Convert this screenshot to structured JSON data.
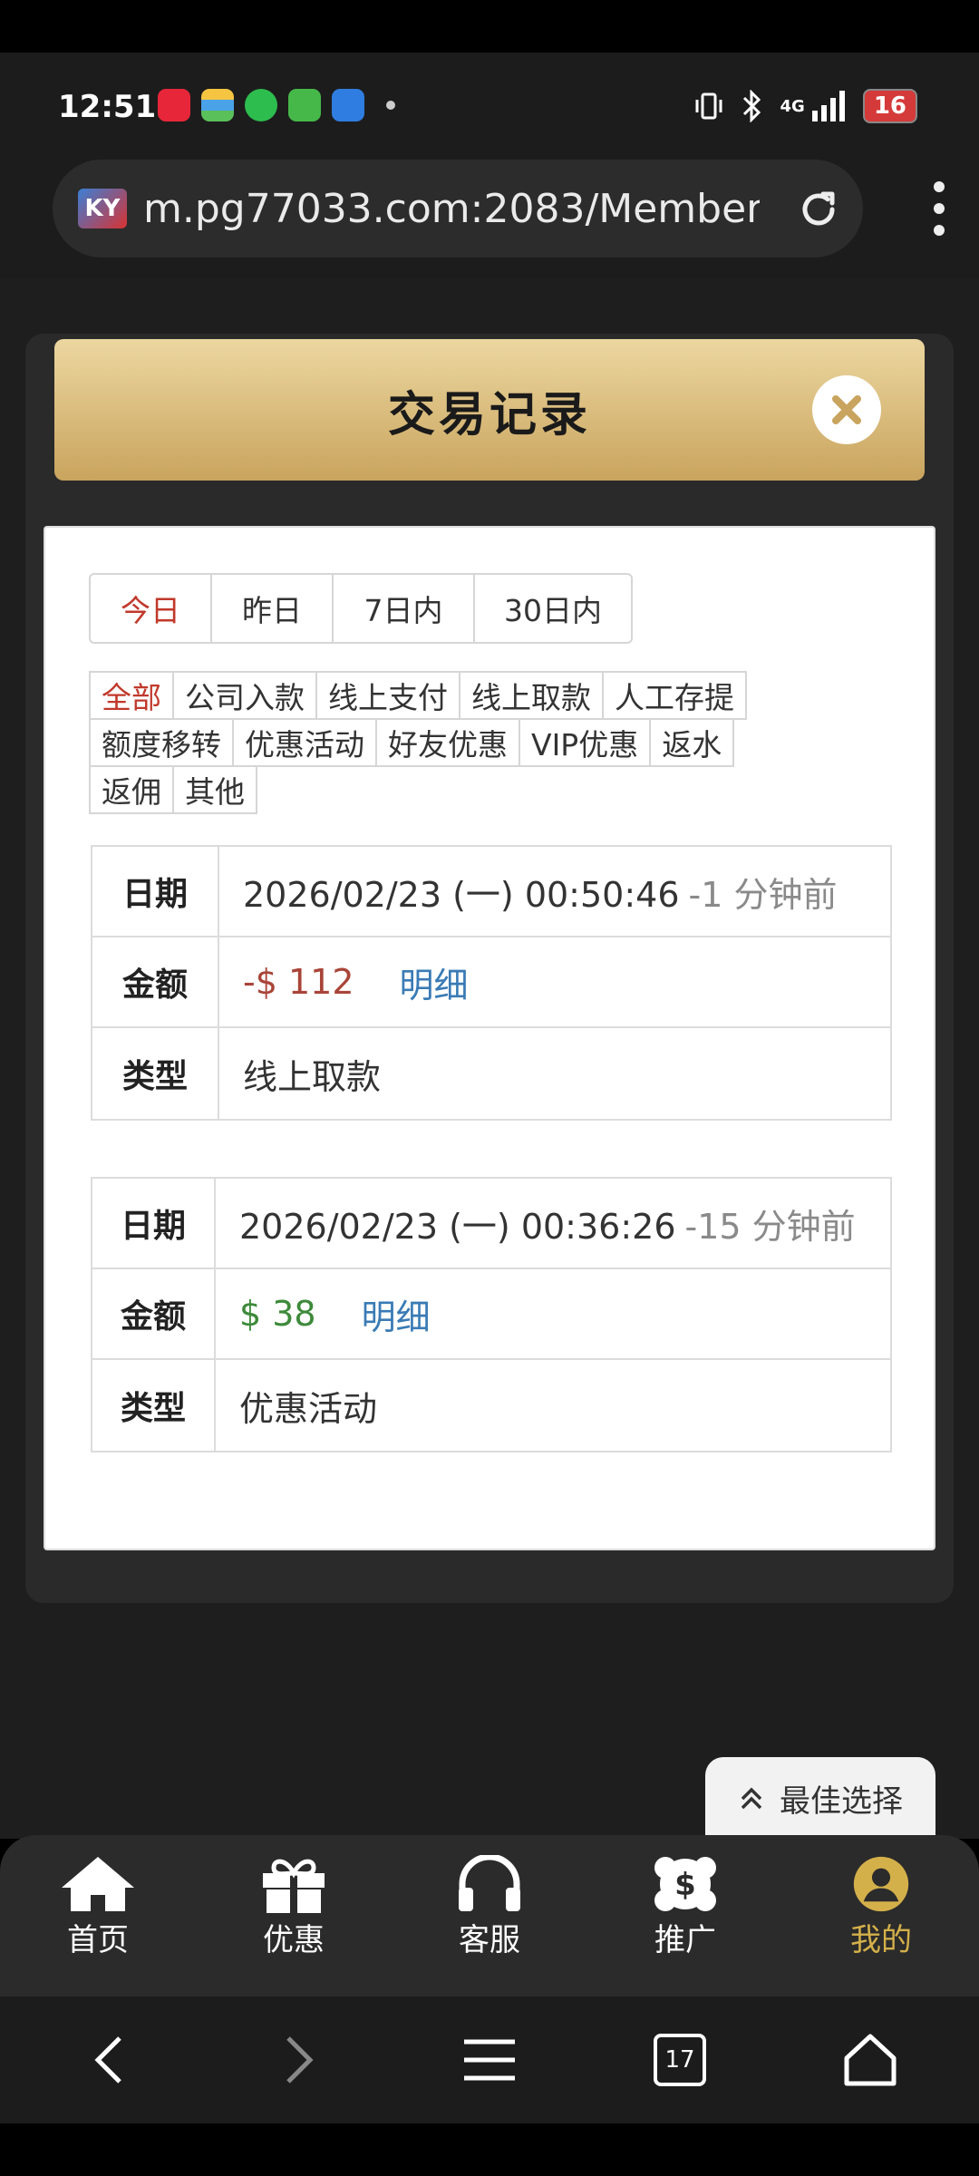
{
  "status_bar": {
    "time": "12:51",
    "network": "4G",
    "battery": "16",
    "app_icons": [
      "xiaohongshu-icon",
      "wallet-icon",
      "message-icon",
      "grid-app-icon",
      "blue-app-icon"
    ]
  },
  "browser": {
    "site_logo": "KY",
    "url": "m.pg77033.com:2083/Member...",
    "tabs_count": "17"
  },
  "dialog": {
    "title": "交易记录"
  },
  "date_tabs": [
    {
      "label": "今日",
      "active": true
    },
    {
      "label": "昨日",
      "active": false
    },
    {
      "label": "7日内",
      "active": false
    },
    {
      "label": "30日内",
      "active": false
    }
  ],
  "type_filters": [
    [
      "全部",
      "公司入款",
      "线上支付",
      "线上取款",
      "人工存提"
    ],
    [
      "额度移转",
      "优惠活动",
      "好友优惠",
      "VIP优惠",
      "返水"
    ],
    [
      "返佣",
      "其他"
    ]
  ],
  "labels": {
    "date": "日期",
    "amount": "金额",
    "type": "类型",
    "detail": "明细"
  },
  "records": [
    {
      "date": "2026/02/23 (一) 00:50:46",
      "ago": "-1 分钟前",
      "amount": "-$ 112",
      "type": "线上取款"
    },
    {
      "date": "2026/02/23 (一) 00:36:26",
      "ago": "-15 分钟前",
      "amount": "$ 38",
      "type": "优惠活动"
    }
  ],
  "best_choice": "最佳选择",
  "bottom_nav": [
    {
      "label": "首页",
      "icon": "home-icon"
    },
    {
      "label": "优惠",
      "icon": "gift-icon"
    },
    {
      "label": "客服",
      "icon": "headset-icon"
    },
    {
      "label": "推广",
      "icon": "dollar-badge-icon"
    },
    {
      "label": "我的",
      "icon": "user-icon",
      "active": true
    }
  ],
  "colors": {
    "accent_gold": "#d4b04a",
    "active_red": "#c0392b",
    "negative": "#a94438",
    "positive": "#3d8a3a",
    "link": "#3a7bb5"
  }
}
